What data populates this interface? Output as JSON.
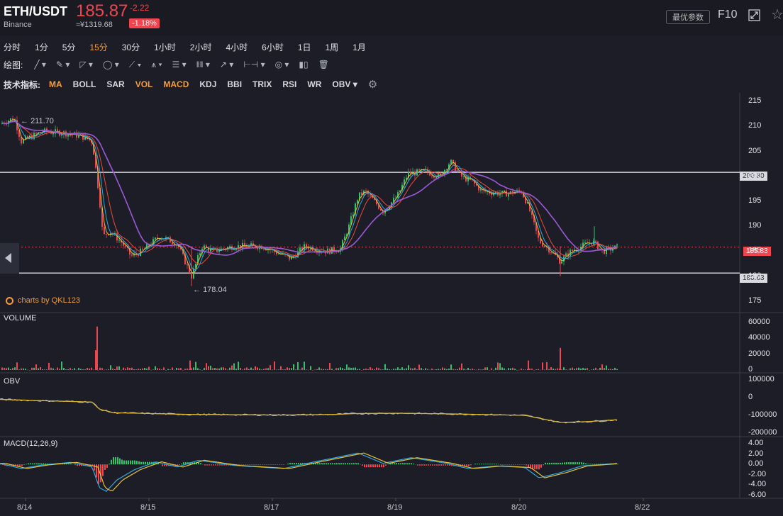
{
  "header": {
    "pair": "ETH/USDT",
    "exchange": "Binance",
    "price": "185.87",
    "price_cny": "≈¥1319.68",
    "change": "-2.22",
    "change_pct": "-1.18%",
    "best_params": "最优参数",
    "f10": "F10"
  },
  "periods": [
    {
      "label": "分时",
      "active": false
    },
    {
      "label": "1分",
      "active": false
    },
    {
      "label": "5分",
      "active": false
    },
    {
      "label": "15分",
      "active": true
    },
    {
      "label": "30分",
      "active": false
    },
    {
      "label": "1小时",
      "active": false
    },
    {
      "label": "2小时",
      "active": false
    },
    {
      "label": "4小时",
      "active": false
    },
    {
      "label": "6小时",
      "active": false
    },
    {
      "label": "1日",
      "active": false
    },
    {
      "label": "1周",
      "active": false
    },
    {
      "label": "1月",
      "active": false
    }
  ],
  "drawing": {
    "label": "绘图:",
    "tools": [
      "line-tool-icon",
      "pen-tool-icon",
      "triangle-tool-icon",
      "circle-tool-icon",
      "wave-tool-icon",
      "pattern-tool-icon",
      "fib-tool-icon",
      "channel-tool-icon",
      "arrow-tool-icon",
      "range-tool-icon",
      "note-tool-icon",
      "chart-tool-icon",
      "trash-icon"
    ]
  },
  "indicators": {
    "label": "技术指标:",
    "items": [
      {
        "label": "MA",
        "on": true
      },
      {
        "label": "BOLL",
        "on": false
      },
      {
        "label": "SAR",
        "on": false
      },
      {
        "label": "VOL",
        "on": true
      },
      {
        "label": "MACD",
        "on": true
      },
      {
        "label": "KDJ",
        "on": false
      },
      {
        "label": "BBI",
        "on": false
      },
      {
        "label": "TRIX",
        "on": false
      },
      {
        "label": "RSI",
        "on": false
      },
      {
        "label": "WR",
        "on": false
      },
      {
        "label": "OBV",
        "on": false
      }
    ]
  },
  "branding": "charts by QKL123",
  "price_pane": {
    "high_label": "211.70",
    "low_label": "178.04",
    "current_tag": "185.83",
    "line_tags": [
      "200.80",
      "180.63"
    ],
    "y_ticks": [
      "215",
      "210",
      "205",
      "200",
      "195",
      "190",
      "185",
      "180",
      "175"
    ]
  },
  "volume_pane": {
    "title": "VOLUME",
    "y_ticks": [
      "60000",
      "40000",
      "20000",
      "0"
    ]
  },
  "obv_pane": {
    "title": "OBV",
    "y_ticks": [
      "100000",
      "0",
      "-100000",
      "-200000"
    ]
  },
  "macd_pane": {
    "title": "MACD(12,26,9)",
    "y_ticks": [
      "4.00",
      "2.00",
      "0.00",
      "-2.00",
      "-4.00",
      "-6.00"
    ]
  },
  "x_ticks": [
    "8/14",
    "8/15",
    "8/17",
    "8/19",
    "8/20",
    "8/22"
  ],
  "colors": {
    "up": "#2ec26b",
    "down": "#f0454e",
    "accent": "#f39c3a",
    "ma_slow": "#9b59d6",
    "ma_fast": "#e6c13a"
  },
  "chart_data": {
    "type": "candlestick",
    "price_range": [
      173,
      217
    ],
    "horizontal_lines": [
      200.8,
      180.63
    ],
    "current_price": 185.83,
    "path": [
      [
        0,
        210.5
      ],
      [
        20,
        211.7
      ],
      [
        30,
        207
      ],
      [
        60,
        209
      ],
      [
        90,
        208.7
      ],
      [
        115,
        208
      ],
      [
        130,
        207
      ],
      [
        140,
        196
      ],
      [
        145,
        188
      ],
      [
        155,
        189
      ],
      [
        170,
        187
      ],
      [
        185,
        184
      ],
      [
        200,
        185
      ],
      [
        225,
        188
      ],
      [
        250,
        186.5
      ],
      [
        270,
        180
      ],
      [
        285,
        186
      ],
      [
        300,
        185
      ],
      [
        330,
        186
      ],
      [
        370,
        186
      ],
      [
        410,
        183.5
      ],
      [
        430,
        186
      ],
      [
        460,
        185
      ],
      [
        480,
        185.5
      ],
      [
        492,
        190
      ],
      [
        505,
        196
      ],
      [
        515,
        197
      ],
      [
        540,
        193
      ],
      [
        560,
        196
      ],
      [
        575,
        200.5
      ],
      [
        600,
        201
      ],
      [
        620,
        200
      ],
      [
        635,
        203
      ],
      [
        650,
        200
      ],
      [
        665,
        199
      ],
      [
        680,
        197
      ],
      [
        710,
        196.5
      ],
      [
        735,
        197
      ],
      [
        745,
        194
      ],
      [
        760,
        187
      ],
      [
        770,
        186
      ],
      [
        790,
        183
      ],
      [
        805,
        185
      ],
      [
        820,
        186
      ],
      [
        835,
        187
      ],
      [
        850,
        185
      ],
      [
        870,
        185.8
      ]
    ],
    "obv_path": [
      [
        0,
        -10000
      ],
      [
        40,
        -15000
      ],
      [
        130,
        -25000
      ],
      [
        140,
        -65000
      ],
      [
        160,
        -85000
      ],
      [
        270,
        -95000
      ],
      [
        400,
        -98000
      ],
      [
        470,
        -95000
      ],
      [
        500,
        -90000
      ],
      [
        560,
        -88000
      ],
      [
        640,
        -92000
      ],
      [
        740,
        -100000
      ],
      [
        790,
        -140000
      ],
      [
        830,
        -135000
      ],
      [
        870,
        -125000
      ]
    ],
    "macd_path": [
      [
        0,
        0.2
      ],
      [
        30,
        -0.8
      ],
      [
        60,
        -0.1
      ],
      [
        100,
        0.4
      ],
      [
        130,
        -0.5
      ],
      [
        140,
        -4.5
      ],
      [
        150,
        -5.2
      ],
      [
        165,
        -3
      ],
      [
        190,
        -1
      ],
      [
        220,
        0.5
      ],
      [
        250,
        -0.5
      ],
      [
        280,
        0.8
      ],
      [
        330,
        -0.2
      ],
      [
        400,
        -0.8
      ],
      [
        440,
        0.4
      ],
      [
        480,
        1.5
      ],
      [
        505,
        2.2
      ],
      [
        540,
        0.2
      ],
      [
        580,
        1.3
      ],
      [
        630,
        0.2
      ],
      [
        660,
        -0.8
      ],
      [
        700,
        -0.3
      ],
      [
        740,
        -0.6
      ],
      [
        760,
        -2.6
      ],
      [
        790,
        -1.6
      ],
      [
        820,
        -0.3
      ],
      [
        870,
        0.2
      ]
    ],
    "volume_spikes": [
      [
        137,
        55000
      ],
      [
        135,
        25000
      ],
      [
        790,
        28000
      ],
      [
        268,
        12000
      ],
      [
        745,
        12000
      ]
    ]
  }
}
